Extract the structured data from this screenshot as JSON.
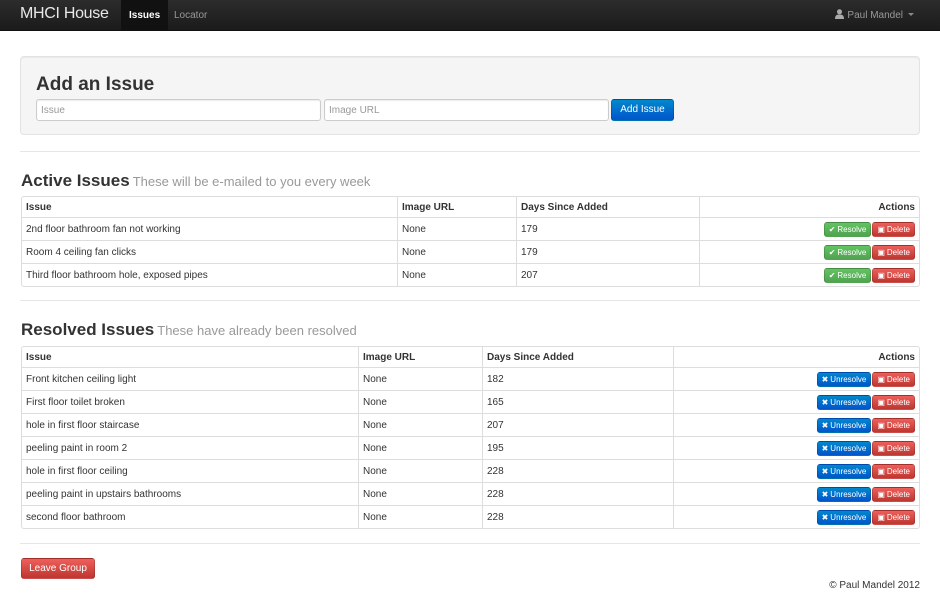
{
  "navbar": {
    "brand": "MHCI House",
    "items": [
      {
        "label": "Issues",
        "active": true
      },
      {
        "label": "Locator",
        "active": false
      }
    ],
    "user": "Paul Mandel",
    "user_icon": "user-icon",
    "dropdown_icon": "caret-down-icon"
  },
  "add_issue": {
    "title": "Add an Issue",
    "issue_placeholder": "Issue",
    "url_placeholder": "Image URL",
    "issue_value": "",
    "url_value": "",
    "button": "Add Issue"
  },
  "active": {
    "title": "Active Issues",
    "subtitle": "These will be e-mailed to you every week",
    "columns": [
      "Issue",
      "Image URL",
      "Days Since Added",
      "Actions"
    ],
    "rows": [
      {
        "issue": "2nd floor bathroom fan not working",
        "url": "None",
        "days": "179"
      },
      {
        "issue": "Room 4 ceiling fan clicks",
        "url": "None",
        "days": "179"
      },
      {
        "issue": "Third floor bathroom hole, exposed pipes",
        "url": "None",
        "days": "207"
      }
    ],
    "resolve_label": "Resolve",
    "delete_label": "Delete"
  },
  "resolved": {
    "title": "Resolved Issues",
    "subtitle": "These have already been resolved",
    "columns": [
      "Issue",
      "Image URL",
      "Days Since Added",
      "Actions"
    ],
    "rows": [
      {
        "issue": "Front kitchen ceiling light",
        "url": "None",
        "days": "182"
      },
      {
        "issue": "First floor toilet broken",
        "url": "None",
        "days": "165"
      },
      {
        "issue": "hole in first floor staircase",
        "url": "None",
        "days": "207"
      },
      {
        "issue": "peeling paint in room 2",
        "url": "None",
        "days": "195"
      },
      {
        "issue": "hole in first floor ceiling",
        "url": "None",
        "days": "228"
      },
      {
        "issue": "peeling paint in upstairs bathrooms",
        "url": "None",
        "days": "228"
      },
      {
        "issue": "second floor bathroom",
        "url": "None",
        "days": "228"
      }
    ],
    "unresolve_label": "Unresolve",
    "delete_label": "Delete"
  },
  "leave_group": "Leave Group",
  "footer": "© Paul Mandel 2012",
  "colors": {
    "primary": "#0088cc",
    "success": "#5bb75b",
    "danger": "#da4f49",
    "navbar": "#222222"
  }
}
